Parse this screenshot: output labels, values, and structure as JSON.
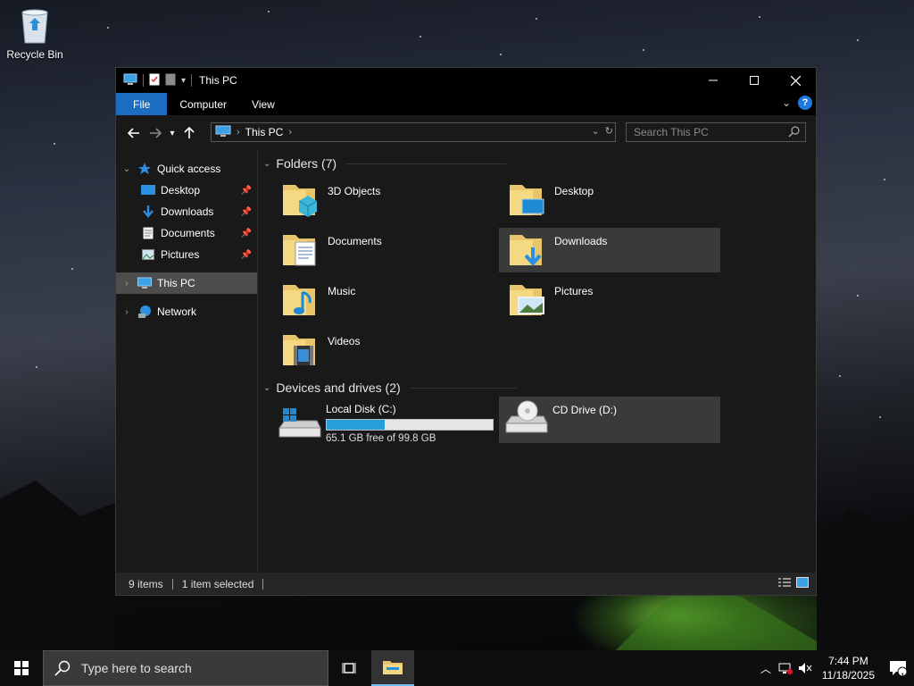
{
  "desktop": {
    "recycle_bin_label": "Recycle Bin"
  },
  "window": {
    "title": "This PC",
    "ribbon_tabs": [
      "File",
      "Computer",
      "View"
    ],
    "controls": {
      "minimize": "minimize-icon",
      "maximize": "maximize-icon",
      "close": "close-icon"
    }
  },
  "navigation": {
    "address_crumb": "This PC",
    "search_placeholder": "Search This PC"
  },
  "sidebar": {
    "quick_access": "Quick access",
    "quick_items": [
      "Desktop",
      "Downloads",
      "Documents",
      "Pictures"
    ],
    "this_pc": "This PC",
    "network": "Network"
  },
  "content": {
    "folders_header": "Folders (7)",
    "folders": [
      "3D Objects",
      "Desktop",
      "Documents",
      "Downloads",
      "Music",
      "Pictures",
      "Videos"
    ],
    "drives_header": "Devices and drives (2)",
    "drives": [
      {
        "name": "Local Disk (C:)",
        "free": "65.1 GB free of 99.8 GB",
        "used_fraction": 0.35
      },
      {
        "name": "CD Drive (D:)"
      }
    ]
  },
  "status": {
    "items": "9 items",
    "selected": "1 item selected"
  },
  "taskbar": {
    "search_placeholder": "Type here to search",
    "time": "7:44 PM",
    "date": "11/18/2025",
    "notification_count": "1"
  },
  "colors": {
    "accent": "#1a6dbf",
    "progress_fill": "#26a0da",
    "selection": "#3a3a3a"
  }
}
